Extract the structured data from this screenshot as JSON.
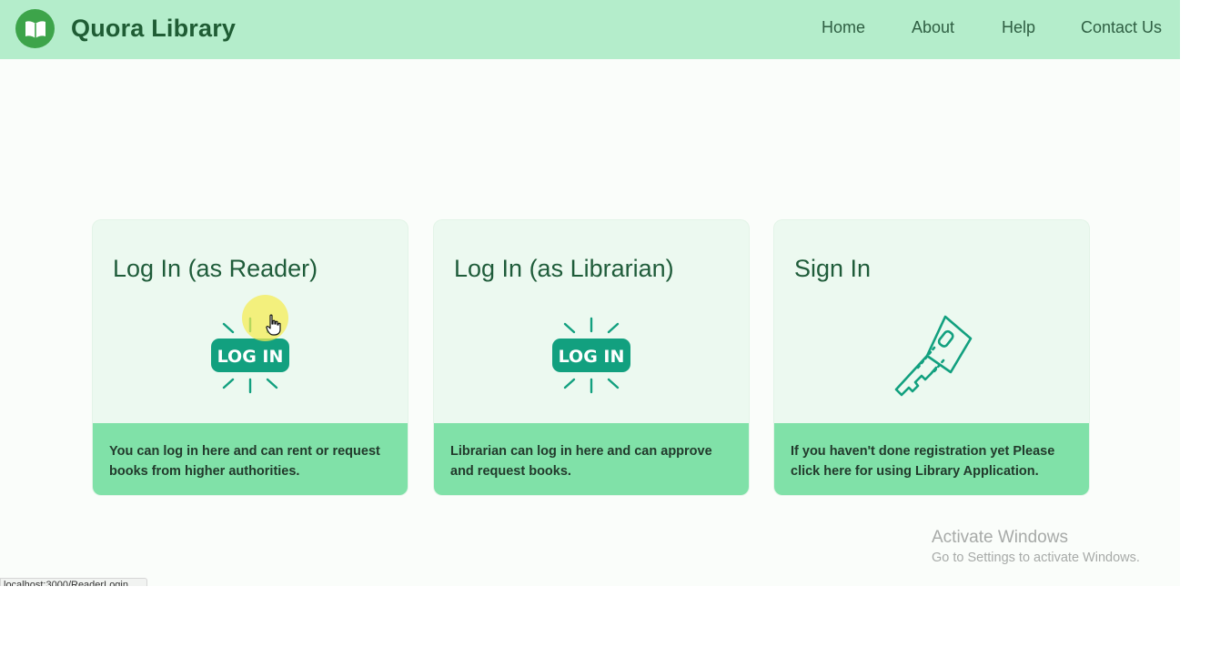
{
  "brand": {
    "name": "Quora Library",
    "icon": "open-book-icon",
    "logo_color": "#3da44a"
  },
  "nav": {
    "home": "Home",
    "about": "About",
    "help": "Help",
    "contact": "Contact Us"
  },
  "cards": [
    {
      "title": "Log In (as Reader)",
      "icon": "log-in-badge-icon",
      "description": "You can log in here and can rent or request books from higher authorities."
    },
    {
      "title": "Log In (as Librarian)",
      "icon": "log-in-badge-icon",
      "description": "Librarian can log in here and can approve and request books."
    },
    {
      "title": "Sign In",
      "icon": "key-icon",
      "description": "If you haven't done registration yet Please click here for using Library Application."
    }
  ],
  "login_badge_text": "LOG IN",
  "status_url": "localhost:3000/ReaderLogin",
  "watermark": {
    "title": "Activate Windows",
    "subtitle": "Go to Settings to activate Windows."
  },
  "colors": {
    "header_bg": "#b4edcb",
    "card_bg": "#ecf9f0",
    "card_footer_bg": "#80e1a8",
    "icon_accent": "#12a07f",
    "title_color": "#1f5c3a"
  }
}
